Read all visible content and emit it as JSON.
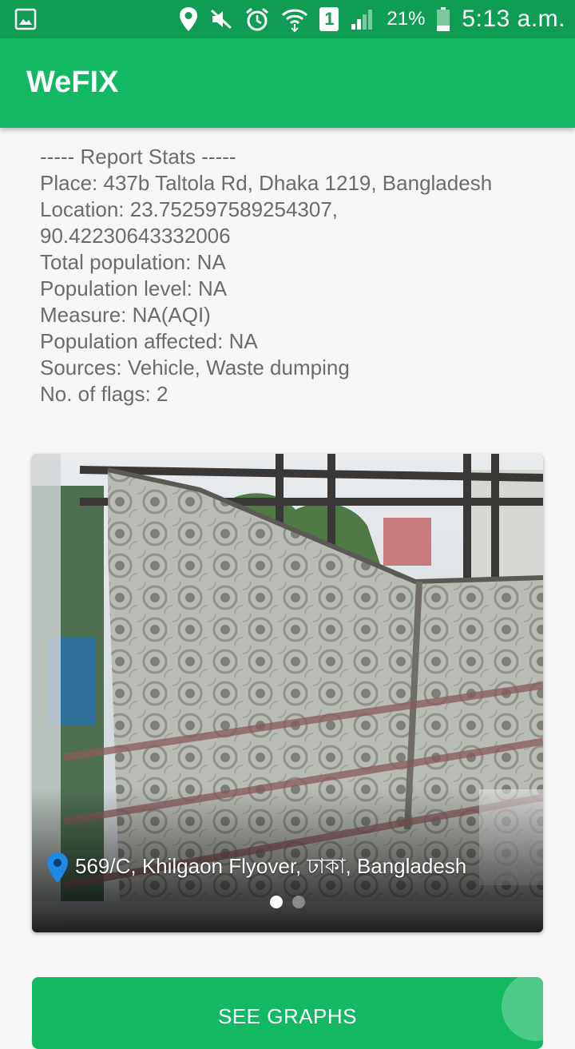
{
  "status_bar": {
    "battery_percent": "21%",
    "time": "5:13 a.m.",
    "sim_slot": "1",
    "icons": [
      "gallery-icon",
      "location-icon",
      "mute-icon",
      "alarm-icon",
      "wifi-icon",
      "sim-icon",
      "signal-icon",
      "battery-icon"
    ]
  },
  "app_bar": {
    "title": "WeFIX"
  },
  "report_stats": {
    "header": "----- Report Stats -----",
    "place": "Place: 437b Taltola Rd, Dhaka 1219, Bangladesh",
    "location_line1": "Location: 23.752597589254307,",
    "location_line2": "90.42230643332006",
    "total_population": "Total population: NA",
    "population_level": "Population level: NA",
    "measure": "Measure: NA(AQI)",
    "population_affected": "Population affected: NA",
    "sources": "Sources: Vehicle, Waste dumping",
    "flags": "No. of flags: 2"
  },
  "image_card": {
    "caption": "569/C, Khilgaon Flyover, ঢাকা, Bangladesh",
    "pager": {
      "count": 2,
      "active_index": 0
    }
  },
  "actions": {
    "see_graphs_label": "SEE GRAPHS"
  },
  "colors": {
    "status_bar": "#0e9d52",
    "app_bar": "#12b862",
    "button": "#12b862",
    "pin": "#1e88e5",
    "stats_text": "#6b6b6b"
  }
}
